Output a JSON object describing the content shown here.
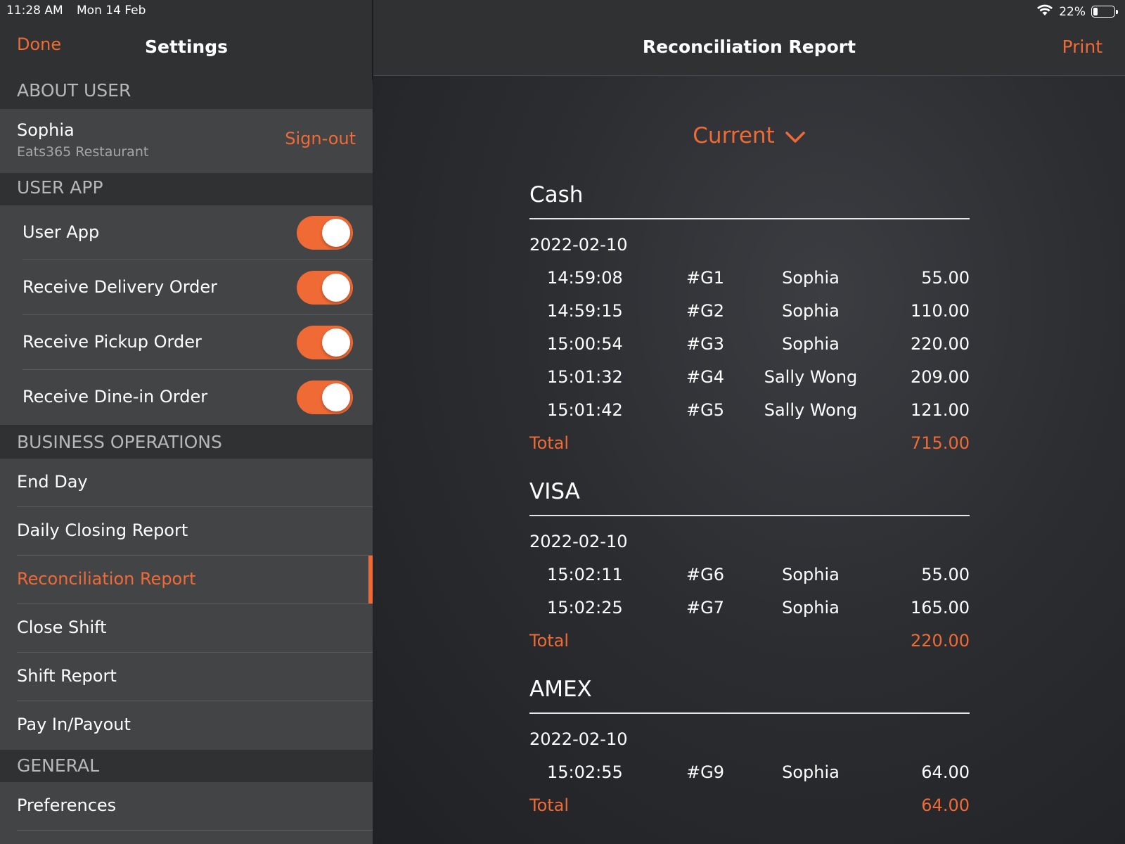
{
  "status_bar": {
    "time": "11:28 AM",
    "date": "Mon 14 Feb",
    "battery_text": "22%",
    "battery_level": 0.22
  },
  "sidebar": {
    "done_label": "Done",
    "title": "Settings",
    "about_user": {
      "header": "ABOUT USER",
      "name": "Sophia",
      "restaurant": "Eats365 Restaurant",
      "signout_label": "Sign-out"
    },
    "user_app": {
      "header": "USER APP",
      "toggles": [
        {
          "label": "User App",
          "on": true
        },
        {
          "label": "Receive Delivery Order",
          "on": true
        },
        {
          "label": "Receive Pickup Order",
          "on": true
        },
        {
          "label": "Receive Dine-in Order",
          "on": true
        }
      ]
    },
    "business_operations": {
      "header": "BUSINESS OPERATIONS",
      "items": [
        {
          "label": "End Day"
        },
        {
          "label": "Daily Closing Report"
        },
        {
          "label": "Reconciliation Report",
          "active": true
        },
        {
          "label": "Close Shift"
        },
        {
          "label": "Shift Report"
        },
        {
          "label": "Pay In/Payout"
        }
      ]
    },
    "general": {
      "header": "GENERAL",
      "items": [
        {
          "label": "Preferences"
        }
      ]
    }
  },
  "main": {
    "title": "Reconciliation Report",
    "print_label": "Print",
    "period_label": "Current",
    "sections": [
      {
        "title": "Cash",
        "date": "2022-02-10",
        "rows": [
          {
            "time": "14:59:08",
            "id": "#G1",
            "user": "Sophia",
            "amount": "55.00"
          },
          {
            "time": "14:59:15",
            "id": "#G2",
            "user": "Sophia",
            "amount": "110.00"
          },
          {
            "time": "15:00:54",
            "id": "#G3",
            "user": "Sophia",
            "amount": "220.00"
          },
          {
            "time": "15:01:32",
            "id": "#G4",
            "user": "Sally Wong",
            "amount": "209.00"
          },
          {
            "time": "15:01:42",
            "id": "#G5",
            "user": "Sally Wong",
            "amount": "121.00"
          }
        ],
        "total_label": "Total",
        "total": "715.00"
      },
      {
        "title": "VISA",
        "date": "2022-02-10",
        "rows": [
          {
            "time": "15:02:11",
            "id": "#G6",
            "user": "Sophia",
            "amount": "55.00"
          },
          {
            "time": "15:02:25",
            "id": "#G7",
            "user": "Sophia",
            "amount": "165.00"
          }
        ],
        "total_label": "Total",
        "total": "220.00"
      },
      {
        "title": "AMEX",
        "date": "2022-02-10",
        "rows": [
          {
            "time": "15:02:55",
            "id": "#G9",
            "user": "Sophia",
            "amount": "64.00"
          }
        ],
        "total_label": "Total",
        "total": "64.00"
      }
    ]
  },
  "colors": {
    "accent": "#f06a35",
    "sidebar_bg": "#303133",
    "row_bg": "#434446",
    "section_header_text": "#b7b7b9"
  }
}
